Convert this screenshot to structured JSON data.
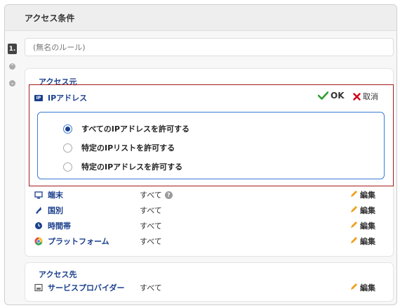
{
  "header": {
    "title": "アクセス条件"
  },
  "rule": {
    "number": "1.",
    "name_placeholder": "(無名のルール)"
  },
  "source_section": {
    "title": "アクセス元",
    "ip": {
      "label": "IPアドレス",
      "icon_text": "IP",
      "ok_label": "OK",
      "cancel_label": "取消",
      "options": [
        {
          "label": "すべてのIPアドレスを許可する",
          "checked": true
        },
        {
          "label": "特定のIPリストを許可する",
          "checked": false
        },
        {
          "label": "特定のIPアドレスを許可する",
          "checked": false
        }
      ]
    },
    "rows": [
      {
        "label": "端末",
        "value": "すべて",
        "has_help": true,
        "help_icon": "?",
        "edit_label": "編集"
      },
      {
        "label": "国別",
        "value": "すべて",
        "has_help": false,
        "edit_label": "編集"
      },
      {
        "label": "時間帯",
        "value": "すべて",
        "has_help": false,
        "edit_label": "編集"
      },
      {
        "label": "プラットフォーム",
        "value": "すべて",
        "has_help": false,
        "edit_label": "編集"
      }
    ]
  },
  "destination_section": {
    "title": "アクセス先",
    "rows": [
      {
        "label": "サービスプロバイダー",
        "value": "すべて",
        "edit_label": "編集"
      }
    ]
  },
  "colors": {
    "accent": "#1a3f8c",
    "ok_check": "#2e9e2e",
    "cancel_x": "#d0021b",
    "edit_border": "#a31b1b",
    "options_border": "#3a7bd5",
    "pencil": "#f0a020"
  }
}
